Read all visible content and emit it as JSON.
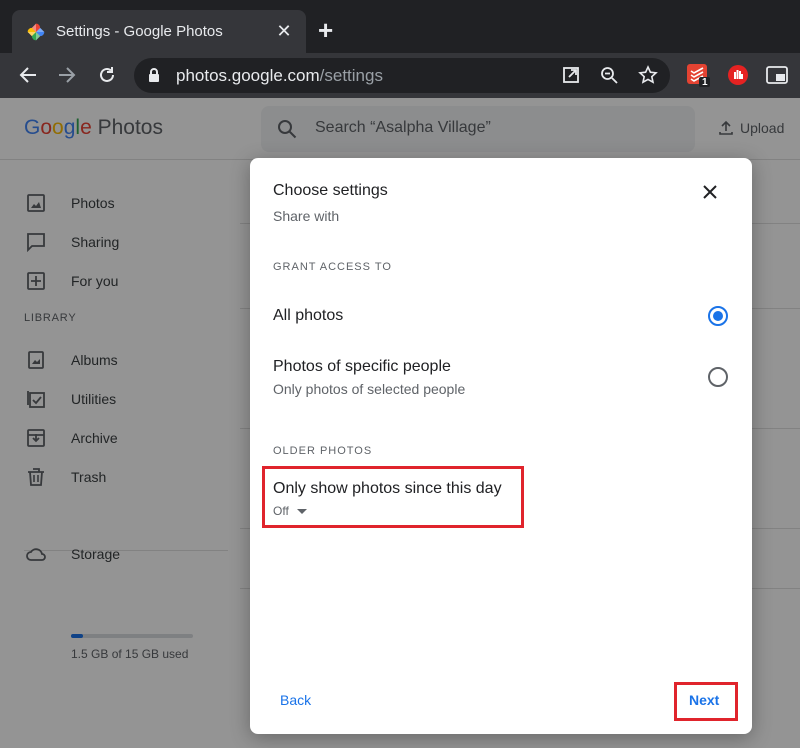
{
  "browser": {
    "tab_title": "Settings - Google Photos",
    "url_host": "photos.google.com",
    "url_path": "/settings",
    "extension_badge": "1"
  },
  "app": {
    "logo_google": [
      "G",
      "o",
      "o",
      "g",
      "l",
      "e"
    ],
    "logo_product": "Photos",
    "search_placeholder": "Search “Asalpha Village”",
    "upload_label": "Upload"
  },
  "sidebar": {
    "items": [
      {
        "label": "Photos",
        "icon": "photo-icon"
      },
      {
        "label": "Sharing",
        "icon": "sharing-icon"
      },
      {
        "label": "For you",
        "icon": "for-you-icon"
      }
    ],
    "library_label": "LIBRARY",
    "library_items": [
      {
        "label": "Albums",
        "icon": "album-icon"
      },
      {
        "label": "Utilities",
        "icon": "utilities-icon"
      },
      {
        "label": "Archive",
        "icon": "archive-icon"
      },
      {
        "label": "Trash",
        "icon": "trash-icon"
      }
    ],
    "storage": {
      "label": "Storage",
      "usage_text": "1.5 GB of 15 GB used",
      "used_fraction": 0.1
    }
  },
  "dialog": {
    "title": "Choose settings",
    "subtitle": "Share with",
    "grant_label": "GRANT ACCESS TO",
    "options": [
      {
        "label": "All photos",
        "sublabel": "",
        "selected": true
      },
      {
        "label": "Photos of specific people",
        "sublabel": "Only photos of selected people",
        "selected": false
      }
    ],
    "older_label": "OLDER PHOTOS",
    "older_option_label": "Only show photos since this day",
    "older_option_value": "Off",
    "back_label": "Back",
    "next_label": "Next"
  },
  "colors": {
    "accent": "#1a73e8",
    "highlight": "#e0242c"
  }
}
